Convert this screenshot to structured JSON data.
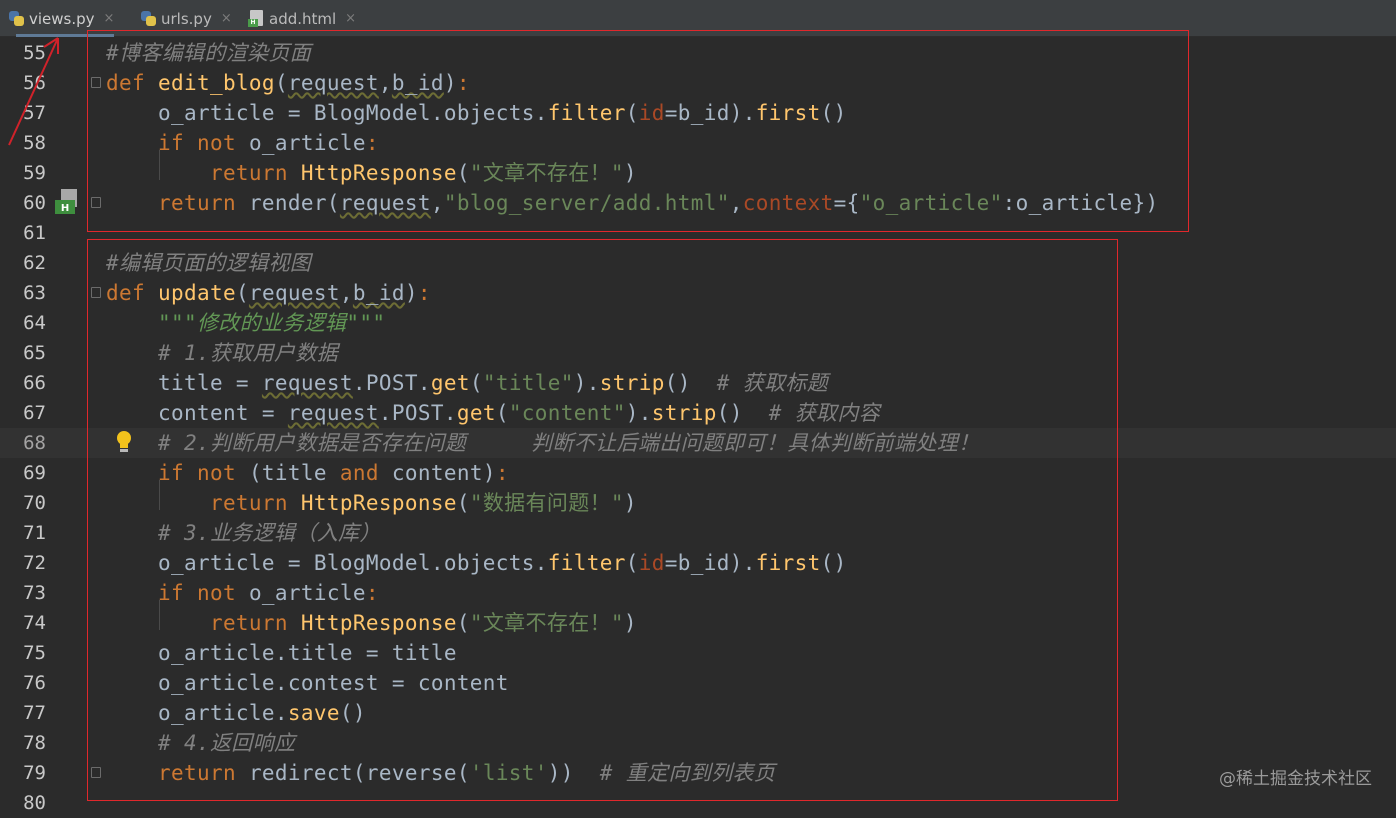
{
  "tabs": [
    {
      "label": "views.py",
      "active": true,
      "icon": "python-file-icon"
    },
    {
      "label": "urls.py",
      "active": false,
      "icon": "python-file-icon"
    },
    {
      "label": "add.html",
      "active": false,
      "icon": "html-file-icon"
    }
  ],
  "tab_close_glyph": "×",
  "lines": [
    {
      "n": "55",
      "t": [
        [
          "cm",
          "#博客编辑的渲染页面"
        ]
      ]
    },
    {
      "n": "56",
      "t": [
        [
          "kw",
          "def "
        ],
        [
          "fn",
          "edit_blog"
        ],
        [
          "pm",
          "("
        ],
        [
          "ulw",
          "request"
        ],
        [
          "pm",
          ","
        ],
        [
          "ulw",
          "b_id"
        ],
        [
          "pm",
          ")"
        ],
        [
          "kw",
          ":"
        ]
      ]
    },
    {
      "n": "57",
      "t": [
        [
          "pm",
          "    o_article = BlogModel.objects."
        ],
        [
          "fn",
          "filter"
        ],
        [
          "pm",
          "("
        ],
        [
          "kwarg",
          "id"
        ],
        [
          "pm",
          "=b_id)."
        ],
        [
          "fn",
          "first"
        ],
        [
          "pm",
          "()"
        ]
      ]
    },
    {
      "n": "58",
      "t": [
        [
          "kw",
          "    if not "
        ],
        [
          "pm",
          "o_article"
        ],
        [
          "kw",
          ":"
        ]
      ]
    },
    {
      "n": "59",
      "t": [
        [
          "kw",
          "        return "
        ],
        [
          "fn",
          "HttpResponse"
        ],
        [
          "pm",
          "("
        ],
        [
          "st",
          "\"文章不存在！\""
        ],
        [
          "pm",
          ")"
        ]
      ]
    },
    {
      "n": "60",
      "t": [
        [
          "kw",
          "    return "
        ],
        [
          "pm",
          "render("
        ],
        [
          "ulw",
          "request"
        ],
        [
          "pm",
          ","
        ],
        [
          "st",
          "\"blog_server/add.html\""
        ],
        [
          "pm",
          ","
        ],
        [
          "kwarg",
          "context"
        ],
        [
          "pm",
          "={"
        ],
        [
          "st",
          "\"o_article\""
        ],
        [
          "pm",
          ":o_article})"
        ]
      ]
    },
    {
      "n": "61",
      "t": []
    },
    {
      "n": "62",
      "t": [
        [
          "cm",
          "#编辑页面的逻辑视图"
        ]
      ]
    },
    {
      "n": "63",
      "t": [
        [
          "kw",
          "def "
        ],
        [
          "fn",
          "update"
        ],
        [
          "pm",
          "("
        ],
        [
          "ulw",
          "request"
        ],
        [
          "pm",
          ","
        ],
        [
          "ulw",
          "b_id"
        ],
        [
          "pm",
          ")"
        ],
        [
          "kw",
          ":"
        ]
      ]
    },
    {
      "n": "64",
      "t": [
        [
          "ds",
          "    \"\"\"修改的业务逻辑\"\"\""
        ]
      ]
    },
    {
      "n": "65",
      "t": [
        [
          "cm",
          "    # 1.获取用户数据"
        ]
      ]
    },
    {
      "n": "66",
      "t": [
        [
          "pm",
          "    title = "
        ],
        [
          "ulw",
          "request"
        ],
        [
          "pm",
          ".POST."
        ],
        [
          "fn",
          "get"
        ],
        [
          "pm",
          "("
        ],
        [
          "st",
          "\"title\""
        ],
        [
          "pm",
          ")."
        ],
        [
          "fn",
          "strip"
        ],
        [
          "pm",
          "()  "
        ],
        [
          "cm",
          "# 获取标题"
        ]
      ]
    },
    {
      "n": "67",
      "t": [
        [
          "pm",
          "    content = "
        ],
        [
          "ulw",
          "request"
        ],
        [
          "pm",
          ".POST."
        ],
        [
          "fn",
          "get"
        ],
        [
          "pm",
          "("
        ],
        [
          "st",
          "\"content\""
        ],
        [
          "pm",
          ")."
        ],
        [
          "fn",
          "strip"
        ],
        [
          "pm",
          "()  "
        ],
        [
          "cm",
          "# 获取内容"
        ]
      ]
    },
    {
      "n": "68",
      "t": [
        [
          "cm",
          "    # 2.判断用户数据是否存在问题     判断不让后端出问题即可！具体判断前端处理！"
        ]
      ]
    },
    {
      "n": "69",
      "t": [
        [
          "kw",
          "    if not "
        ],
        [
          "pm",
          "(title "
        ],
        [
          "kw",
          "and "
        ],
        [
          "pm",
          "content)"
        ],
        [
          "kw",
          ":"
        ]
      ]
    },
    {
      "n": "70",
      "t": [
        [
          "kw",
          "        return "
        ],
        [
          "fn",
          "HttpResponse"
        ],
        [
          "pm",
          "("
        ],
        [
          "st",
          "\"数据有问题！\""
        ],
        [
          "pm",
          ")"
        ]
      ]
    },
    {
      "n": "71",
      "t": [
        [
          "cm",
          "    # 3.业务逻辑（入库）"
        ]
      ]
    },
    {
      "n": "72",
      "t": [
        [
          "pm",
          "    o_article = BlogModel.objects."
        ],
        [
          "fn",
          "filter"
        ],
        [
          "pm",
          "("
        ],
        [
          "kwarg",
          "id"
        ],
        [
          "pm",
          "=b_id)."
        ],
        [
          "fn",
          "first"
        ],
        [
          "pm",
          "()"
        ]
      ]
    },
    {
      "n": "73",
      "t": [
        [
          "kw",
          "    if not "
        ],
        [
          "pm",
          "o_article"
        ],
        [
          "kw",
          ":"
        ]
      ]
    },
    {
      "n": "74",
      "t": [
        [
          "kw",
          "        return "
        ],
        [
          "fn",
          "HttpResponse"
        ],
        [
          "pm",
          "("
        ],
        [
          "st",
          "\"文章不存在！\""
        ],
        [
          "pm",
          ")"
        ]
      ]
    },
    {
      "n": "75",
      "t": [
        [
          "pm",
          "    o_article.title = title"
        ]
      ]
    },
    {
      "n": "76",
      "t": [
        [
          "pm",
          "    o_article.contest = content"
        ]
      ]
    },
    {
      "n": "77",
      "t": [
        [
          "pm",
          "    o_article."
        ],
        [
          "fn",
          "save"
        ],
        [
          "pm",
          "()"
        ]
      ]
    },
    {
      "n": "78",
      "t": [
        [
          "cm",
          "    # 4.返回响应"
        ]
      ]
    },
    {
      "n": "79",
      "t": [
        [
          "kw",
          "    return "
        ],
        [
          "pm",
          "redirect(reverse("
        ],
        [
          "st",
          "'list'"
        ],
        [
          "pm",
          "))  "
        ],
        [
          "cm",
          "# 重定向到列表页"
        ]
      ]
    },
    {
      "n": "80",
      "t": []
    }
  ],
  "current_line": "68",
  "icons": {
    "run_gutter": "html-template-gutter-icon",
    "intention": "lightbulb-icon"
  },
  "watermark": "@稀土掘金技术社区",
  "colors": {
    "background": "#2b2b2b",
    "highlight_box": "#e0282c",
    "keyword": "#cc7832",
    "function": "#ffc66d",
    "string": "#6a8759",
    "comment": "#808080"
  }
}
